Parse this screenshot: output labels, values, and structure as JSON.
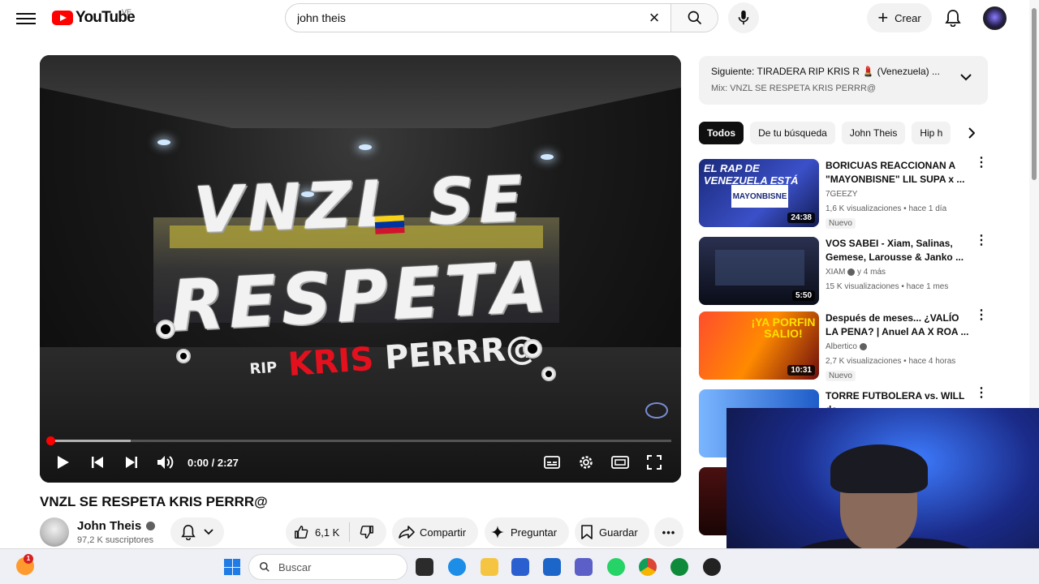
{
  "topbar": {
    "logo_text": "YouTube",
    "logo_country": "VE",
    "search_value": "john theis",
    "create_label": "Crear"
  },
  "player": {
    "video_title_line1": "VNZL SE",
    "video_title_line2": "RESPETA",
    "video_title_rip": "RIP",
    "video_title_kris": "KRIS",
    "video_title_perr": "PERRR@",
    "timecode": "0:00 / 2:27",
    "progress_fraction": 0.0,
    "buffer_fraction": 0.13
  },
  "video": {
    "title": "VNZL SE RESPETA KRIS PERRR@",
    "channel_name": "John Theis",
    "subscribers": "97,2 K suscriptores",
    "likes": "6,1 K",
    "share_label": "Compartir",
    "ask_label": "Preguntar",
    "save_label": "Guardar"
  },
  "next": {
    "label": "Siguiente:",
    "title": "TIRADERA RIP KRIS R 💄 (Venezuela) ...",
    "mix": "Mix: VNZL SE RESPETA KRIS PERRR@"
  },
  "chips": [
    "Todos",
    "De tu búsqueda",
    "John Theis",
    "Hip h"
  ],
  "recommendations": [
    {
      "title": "BORICUAS REACCIONAN A \"MAYONBISNE\" LIL SUPA x ...",
      "channel": "7GEEZY",
      "meta": "1,6 K visualizaciones • hace 1 día",
      "badge": "Nuevo",
      "duration": "24:38",
      "thumb_text": "EL RAP DE VENEZUELA ESTÁ",
      "thumb_text2": "MAYONBISNE"
    },
    {
      "title": "VOS SABEI - Xiam, Salinas, Gemese, Larousse & Janko ...",
      "channel": "XIAM",
      "channel_extra": "y 4 más",
      "meta": "15 K visualizaciones • hace 1 mes",
      "duration": "5:50"
    },
    {
      "title": "Después de meses... ¿VALÍO LA PENA? | Anuel AA X ROA ...",
      "channel": "Albertico",
      "meta": "2,7 K visualizaciones • hace 4 horas",
      "badge": "Nuevo",
      "duration": "10:31",
      "thumb_text": "¡YA PORFIN SALIO!"
    },
    {
      "title": "TORRE FUTBOLERA vs. WILL de"
    }
  ],
  "taskbar": {
    "search_label": "Buscar",
    "notification_count": "1"
  },
  "colors": {
    "youtube_red": "#ff0000",
    "chip_active": "#0f0f0f",
    "muted_text": "#606060"
  }
}
